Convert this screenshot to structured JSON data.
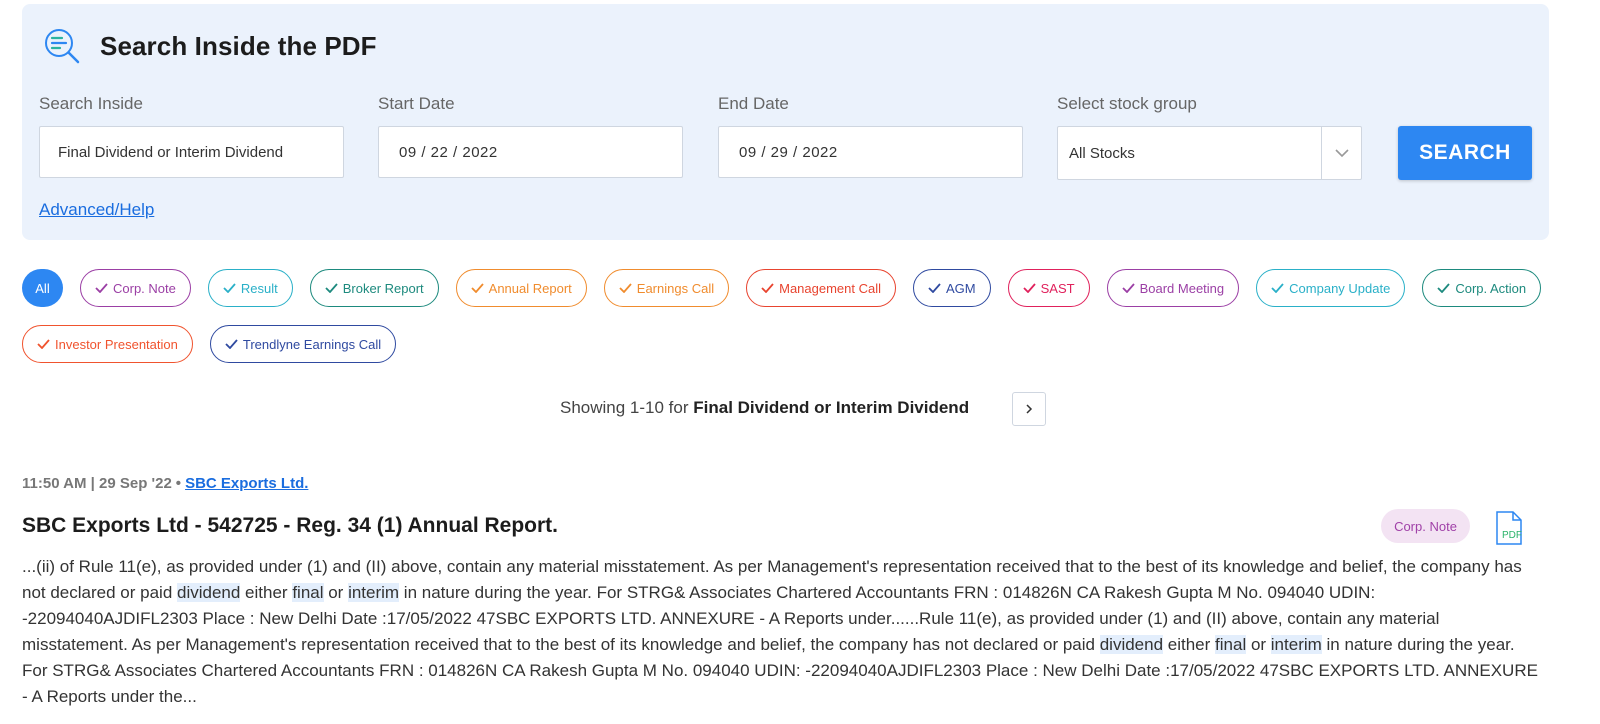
{
  "panel": {
    "title": "Search Inside the PDF",
    "icon": "document-search-icon",
    "fields": {
      "search_inside": {
        "label": "Search Inside",
        "value": "Final Dividend or Interim Dividend"
      },
      "start_date": {
        "label": "Start Date",
        "value": "09 / 22 / 2022"
      },
      "end_date": {
        "label": "End Date",
        "value": "09 / 29 / 2022"
      },
      "stock_group": {
        "label": "Select stock group",
        "value": "All Stocks"
      }
    },
    "search_button": "SEARCH",
    "advanced_link": "Advanced/Help"
  },
  "filters": {
    "all_label": "All",
    "chips": [
      {
        "label": "Corp. Note",
        "color": "#9b3fa5"
      },
      {
        "label": "Result",
        "color": "#2ab0c8"
      },
      {
        "label": "Broker Report",
        "color": "#1d8a7e"
      },
      {
        "label": "Annual Report",
        "color": "#f08c2e"
      },
      {
        "label": "Earnings Call",
        "color": "#f08c2e"
      },
      {
        "label": "Management Call",
        "color": "#e8442f"
      },
      {
        "label": "AGM",
        "color": "#2f4aa0"
      },
      {
        "label": "SAST",
        "color": "#e0215c"
      },
      {
        "label": "Board Meeting",
        "color": "#9b3fa5"
      },
      {
        "label": "Company Update",
        "color": "#2ab0c8"
      },
      {
        "label": "Corp. Action",
        "color": "#1d8a7e"
      },
      {
        "label": "Investor Presentation",
        "color": "#f0532e"
      },
      {
        "label": "Trendlyne Earnings Call",
        "color": "#2f4aa0"
      }
    ]
  },
  "results": {
    "summary_prefix": "Showing 1-10 for",
    "summary_query": "Final Dividend or Interim Dividend",
    "next_icon": "chevron-right-icon"
  },
  "result": {
    "time": "11:50 AM | 29 Sep '22",
    "company": "SBC Exports Ltd.",
    "title": "SBC Exports Ltd - 542725 - Reg. 34 (1) Annual Report.",
    "tag": "Corp. Note",
    "pdf_icon": "pdf-file-icon",
    "snippet": [
      {
        "text": "...(ii) of Rule 11(e), as provided under (1) and (II) above, contain any material misstatement. As per Management's representation received that to the best of its knowledge and belief, the company has not declared or paid ",
        "hl": false
      },
      {
        "text": "dividend",
        "hl": true
      },
      {
        "text": " either ",
        "hl": false
      },
      {
        "text": "final",
        "hl": true
      },
      {
        "text": " or ",
        "hl": false
      },
      {
        "text": "interim",
        "hl": true
      },
      {
        "text": " in nature during the year. For STRG& Associates Chartered Accountants FRN : 014826N CA Rakesh Gupta M No. 094040 UDIN: -22094040AJDIFL2303 Place : New Delhi Date :17/05/2022 47SBC EXPORTS LTD. ANNEXURE - A Reports under......Rule 11(e), as provided under (1) and (II) above, contain any material misstatement. As per Management's representation received that to the best of its knowledge and belief, the company has not declared or paid ",
        "hl": false
      },
      {
        "text": "dividend",
        "hl": true
      },
      {
        "text": " either ",
        "hl": false
      },
      {
        "text": "final",
        "hl": true
      },
      {
        "text": " or ",
        "hl": false
      },
      {
        "text": "interim",
        "hl": true
      },
      {
        "text": " in nature during the year. For STRG& Associates Chartered Accountants FRN : 014826N CA Rakesh Gupta M No. 094040 UDIN: -22094040AJDIFL2303 Place : New Delhi Date :17/05/2022 47SBC EXPORTS LTD. ANNEXURE - A Reports under the...",
        "hl": false
      }
    ]
  },
  "colors": {
    "accent": "#2d87f2",
    "panel_bg": "#ebf2fc",
    "link": "#1a6ddf",
    "highlight": "#e3eefc"
  }
}
